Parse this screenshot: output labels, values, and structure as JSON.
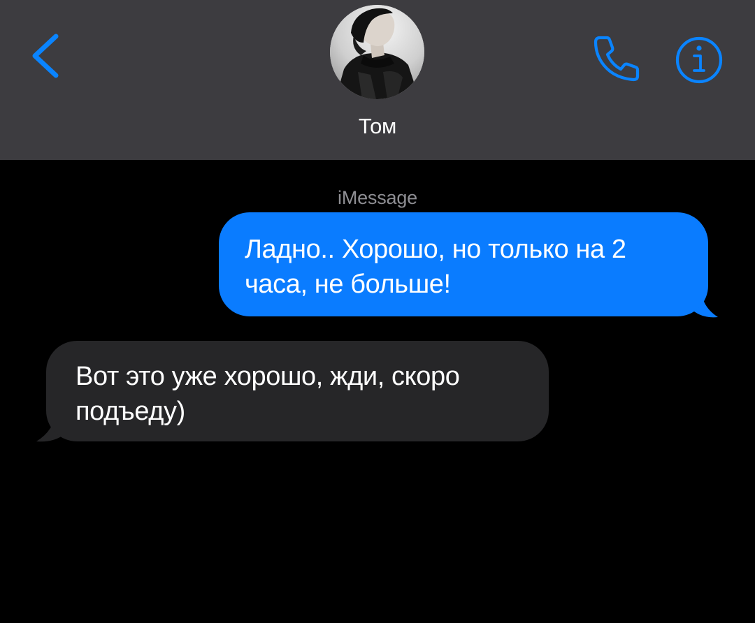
{
  "header": {
    "contact_name": "Том",
    "accent_color": "#0a84ff",
    "back_icon": "chevron-left-icon",
    "call_icon": "phone-icon",
    "info_icon": "info-circle-icon"
  },
  "conversation": {
    "service_label": "iMessage",
    "messages": [
      {
        "direction": "outgoing",
        "lines": [
          "Ладно.. Хорошо, но только на 2",
          "часа, не больше!"
        ],
        "bubble_color": "#0a7cff"
      },
      {
        "direction": "incoming",
        "lines": [
          "Вот это уже хорошо, жди, скоро",
          "подъеду)"
        ],
        "bubble_color": "#262628"
      }
    ]
  }
}
